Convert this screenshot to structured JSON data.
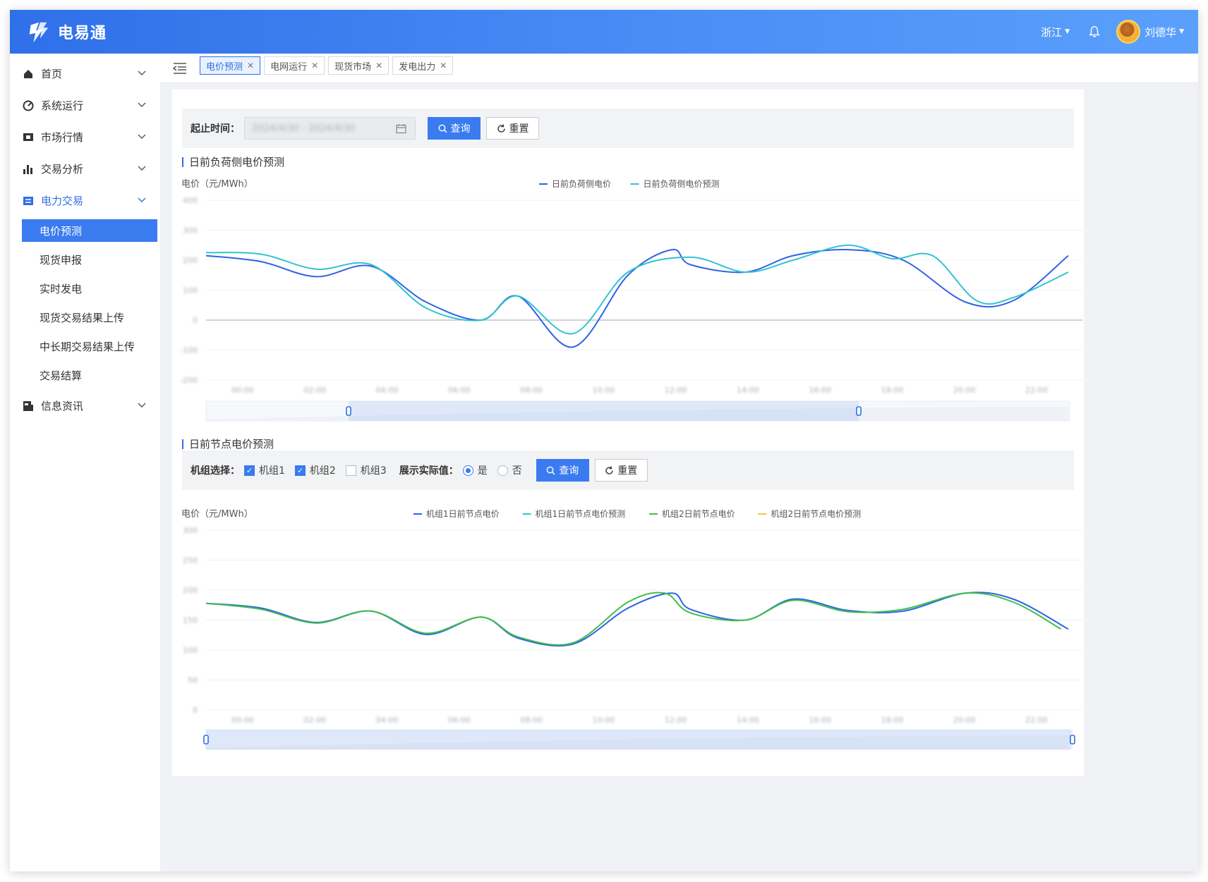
{
  "app": {
    "name": "电易通"
  },
  "header": {
    "region": "浙江",
    "user": "刘德华"
  },
  "sidebar": {
    "items": [
      {
        "label": "首页"
      },
      {
        "label": "系统运行"
      },
      {
        "label": "市场行情"
      },
      {
        "label": "交易分析"
      },
      {
        "label": "电力交易"
      },
      {
        "label": "信息资讯"
      }
    ],
    "sub_items": [
      {
        "label": "电价预测"
      },
      {
        "label": "现货申报"
      },
      {
        "label": "实时发电"
      },
      {
        "label": "现货交易结果上传"
      },
      {
        "label": "中长期交易结果上传"
      },
      {
        "label": "交易结算"
      }
    ]
  },
  "tabs": [
    {
      "label": "电价预测"
    },
    {
      "label": "电网运行"
    },
    {
      "label": "现货市场"
    },
    {
      "label": "发电出力"
    }
  ],
  "filter1": {
    "label": "起止时间：",
    "date_value": "2024/4/30 - 2024/4/30",
    "query": "查询",
    "reset": "重置"
  },
  "section1": {
    "title": "日前负荷侧电价预测"
  },
  "section2": {
    "title": "日前节点电价预测"
  },
  "filter2": {
    "unit_label": "机组选择：",
    "units": [
      {
        "label": "机组1",
        "checked": true
      },
      {
        "label": "机组2",
        "checked": true
      },
      {
        "label": "机组3",
        "checked": false
      }
    ],
    "show_actual_label": "展示实际值：",
    "yes": "是",
    "no": "否",
    "query": "查询",
    "reset": "重置"
  },
  "chart_data": [
    {
      "type": "line",
      "title": "日前负荷侧电价预测",
      "ylabel": "电价（元/MWh）",
      "ylim": [
        -200,
        400
      ],
      "yticks": [
        "-200",
        "-100",
        "0",
        "100",
        "200",
        "300",
        "400"
      ],
      "categories": [
        "00:00",
        "02:00",
        "04:00",
        "06:00",
        "08:00",
        "10:00",
        "12:00",
        "14:00",
        "16:00",
        "18:00",
        "20:00",
        "22:00"
      ],
      "x_end": 23.5,
      "legend_position": "top-center",
      "colors": [
        "#2f63e6",
        "#33c3d2"
      ],
      "series": [
        {
          "name": "日前负荷侧电价",
          "x": [
            0,
            1.5,
            3,
            4.5,
            6,
            7.5,
            8.5,
            10,
            11.5,
            12.7,
            13.2,
            14.7,
            16,
            17.5,
            19,
            20.7,
            22,
            23.5
          ],
          "values": [
            215,
            195,
            145,
            180,
            60,
            0,
            80,
            -90,
            150,
            235,
            185,
            160,
            215,
            235,
            200,
            60,
            65,
            215
          ]
        },
        {
          "name": "日前负荷侧电价预测",
          "x": [
            0,
            1.5,
            3,
            4.5,
            6,
            7.5,
            8.5,
            10,
            11.5,
            13.2,
            14.7,
            16,
            17.5,
            18.7,
            19.8,
            21,
            22,
            23.5
          ],
          "values": [
            225,
            220,
            170,
            185,
            40,
            0,
            80,
            -45,
            160,
            210,
            160,
            200,
            250,
            205,
            215,
            65,
            75,
            160
          ]
        }
      ]
    },
    {
      "type": "line",
      "title": "日前节点电价预测",
      "ylabel": "电价（元/MWh）",
      "ylim": [
        0,
        300
      ],
      "yticks": [
        "0",
        "50",
        "100",
        "150",
        "200",
        "250",
        "300"
      ],
      "categories": [
        "00:00",
        "02:00",
        "04:00",
        "06:00",
        "08:00",
        "10:00",
        "12:00",
        "14:00",
        "16:00",
        "18:00",
        "20:00",
        "22:00"
      ],
      "x_end": 23.5,
      "legend_position": "top-center",
      "colors": [
        "#2f63e6",
        "#33c3d2",
        "#3fbf4a",
        "#f0c93a"
      ],
      "series": [
        {
          "name": "机组1日前节点电价",
          "x": [
            0,
            1.5,
            3,
            4.5,
            6,
            7.5,
            8.5,
            10,
            11.5,
            12.7,
            13.2,
            14.7,
            16,
            17.5,
            19,
            20.7,
            22,
            23.5
          ],
          "values": [
            178,
            170,
            146,
            165,
            126,
            155,
            120,
            110,
            170,
            195,
            168,
            150,
            185,
            166,
            165,
            195,
            185,
            135
          ]
        },
        {
          "name": "机组1日前节点电价预测",
          "x": [],
          "values": []
        },
        {
          "name": "机组2日前节点电价",
          "x": [
            0,
            1.5,
            3,
            4.5,
            6,
            7.5,
            8.5,
            10,
            11.5,
            12.5,
            13.2,
            14.7,
            16,
            17.5,
            19,
            20.7,
            22,
            23.3
          ],
          "values": [
            178,
            168,
            145,
            165,
            128,
            155,
            122,
            112,
            180,
            195,
            162,
            150,
            183,
            164,
            168,
            195,
            180,
            135
          ]
        },
        {
          "name": "机组2日前节点电价预测",
          "x": [],
          "values": []
        }
      ]
    }
  ]
}
